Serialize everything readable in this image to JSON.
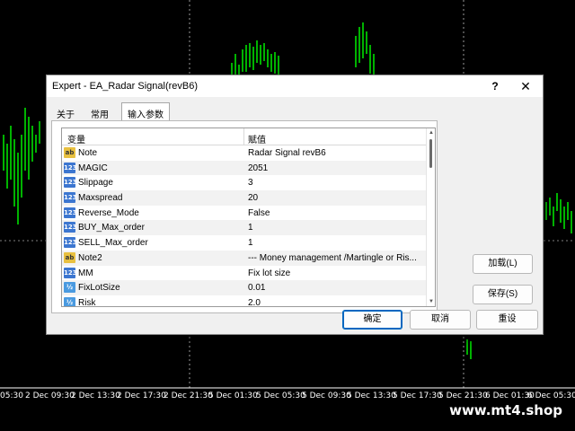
{
  "chart": {
    "time_labels": [
      "05:30",
      "2 Dec 09:30",
      "2 Dec 13:30",
      "2 Dec 17:30",
      "2 Dec 21:30",
      "5 Dec 01:30",
      "5 Dec 05:30",
      "5 Dec 09:30",
      "5 Dec 13:30",
      "5 Dec 17:30",
      "5 Dec 21:30",
      "6 Dec 01:30",
      "6 Dec 05:30"
    ],
    "candle_color": "#00e000",
    "grid_color": "#ffffff"
  },
  "watermark": "www.mt4.shop",
  "dialog": {
    "title": "Expert - EA_Radar Signal(revB6)",
    "help_label": "?",
    "close_label": "✕",
    "tabs": [
      "关于",
      "常用",
      "输入参数"
    ],
    "active_tab": "输入参数",
    "columns": {
      "variable": "变量",
      "value": "赋值"
    },
    "params": [
      {
        "icon": "ab",
        "name": "Note",
        "value": "Radar Signal revB6"
      },
      {
        "icon": "123",
        "name": "MAGIC",
        "value": "2051"
      },
      {
        "icon": "123",
        "name": "Slippage",
        "value": "3"
      },
      {
        "icon": "123",
        "name": "Maxspread",
        "value": "20"
      },
      {
        "icon": "123",
        "name": "Reverse_Mode",
        "value": "False"
      },
      {
        "icon": "123",
        "name": "BUY_Max_order",
        "value": "1"
      },
      {
        "icon": "123",
        "name": "SELL_Max_order",
        "value": "1"
      },
      {
        "icon": "ab",
        "name": "Note2",
        "value": "--- Money management /Martingle or Ris..."
      },
      {
        "icon": "123",
        "name": "MM",
        "value": "Fix lot size"
      },
      {
        "icon": "½",
        "name": "FixLotSize",
        "value": "0.01"
      },
      {
        "icon": "½",
        "name": "Risk",
        "value": "2.0"
      }
    ],
    "buttons": {
      "load": "加载(L)",
      "save": "保存(S)",
      "ok": "确定",
      "cancel": "取消",
      "reset": "重设"
    }
  }
}
